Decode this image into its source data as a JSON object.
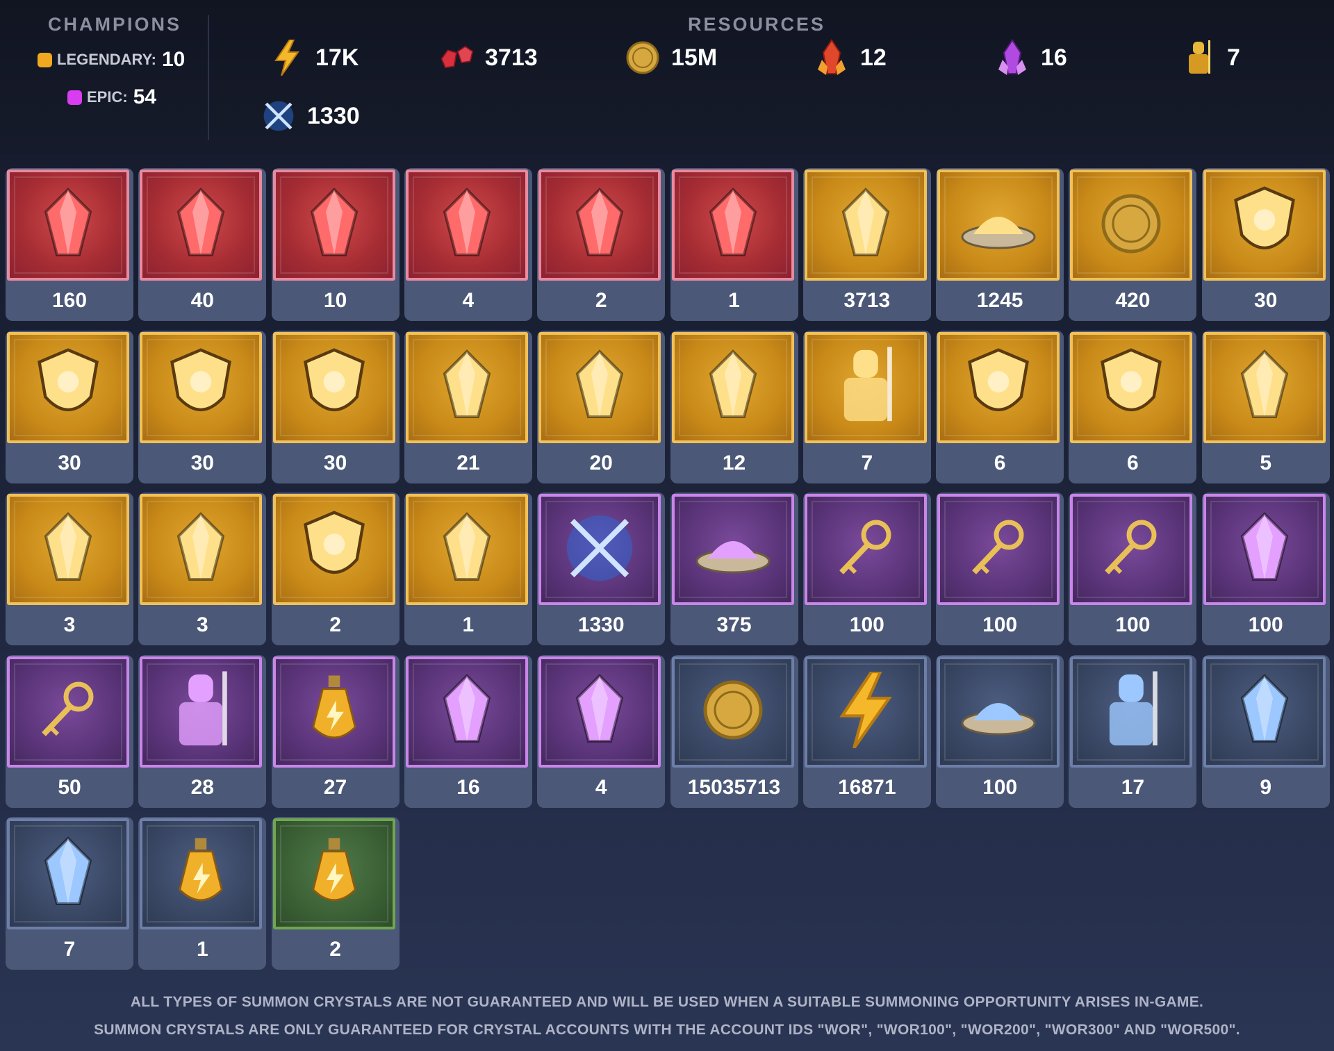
{
  "champions": {
    "title": "CHAMPIONS",
    "legendary_label": "LEGENDARY:",
    "legendary_value": "10",
    "epic_label": "EPIC:",
    "epic_value": "54",
    "colors": {
      "legendary": "#f0a820",
      "epic": "#d83df0"
    }
  },
  "resources": {
    "title": "RESOURCES",
    "items": [
      {
        "icon": "energy-bolt-icon",
        "value": "17K"
      },
      {
        "icon": "ruby-gems-icon",
        "value": "3713"
      },
      {
        "icon": "gold-coin-icon",
        "value": "15M"
      },
      {
        "icon": "red-crystal-icon",
        "value": "12"
      },
      {
        "icon": "purple-crystal-icon",
        "value": "16"
      },
      {
        "icon": "gold-knight-icon",
        "value": "7"
      },
      {
        "icon": "crossed-swords-icon",
        "value": "1330"
      }
    ]
  },
  "items": [
    {
      "tier": "red",
      "icon": "red-crystal-shard-icon",
      "value": "160"
    },
    {
      "tier": "red",
      "icon": "gold-claw-ruby-icon",
      "value": "40"
    },
    {
      "tier": "red",
      "icon": "spider-medallion-icon",
      "value": "10"
    },
    {
      "tier": "red",
      "icon": "pyramid-gem-icon",
      "value": "4"
    },
    {
      "tier": "red",
      "icon": "purple-hex-gem-icon",
      "value": "2"
    },
    {
      "tier": "red",
      "icon": "chameleon-medallion-icon",
      "value": "1"
    },
    {
      "tier": "gold",
      "icon": "ruby-gems-icon",
      "value": "3713"
    },
    {
      "tier": "gold",
      "icon": "fire-dust-bowl-icon",
      "value": "1245"
    },
    {
      "tier": "gold",
      "icon": "rune-coin-icon",
      "value": "420"
    },
    {
      "tier": "gold",
      "icon": "blue-shield-emblem-icon",
      "value": "30"
    },
    {
      "tier": "gold",
      "icon": "red-shield-emblem-icon",
      "value": "30"
    },
    {
      "tier": "gold",
      "icon": "gold-shield-emblem-icon",
      "value": "30"
    },
    {
      "tier": "gold",
      "icon": "green-shield-emblem-icon",
      "value": "30"
    },
    {
      "tier": "gold",
      "icon": "golden-orb-icon",
      "value": "21"
    },
    {
      "tier": "gold",
      "icon": "ruby-claw-icon",
      "value": "20"
    },
    {
      "tier": "gold",
      "icon": "red-crystal-icon",
      "value": "12"
    },
    {
      "tier": "gold",
      "icon": "gold-knight-icon",
      "value": "7"
    },
    {
      "tier": "gold",
      "icon": "sun-crest-shield-icon",
      "value": "6"
    },
    {
      "tier": "gold",
      "icon": "sword-crest-shield-icon",
      "value": "6"
    },
    {
      "tier": "gold",
      "icon": "blue-tome-icon",
      "value": "5"
    },
    {
      "tier": "gold",
      "icon": "war-hammer-icon",
      "value": "3"
    },
    {
      "tier": "gold",
      "icon": "golden-spark-icon",
      "value": "3"
    },
    {
      "tier": "gold",
      "icon": "strength-crest-icon",
      "value": "2"
    },
    {
      "tier": "gold",
      "icon": "scroll-quill-icon",
      "value": "1"
    },
    {
      "tier": "purple",
      "icon": "crossed-swords-icon",
      "value": "1330"
    },
    {
      "tier": "purple",
      "icon": "purple-dust-bowl-icon",
      "value": "375"
    },
    {
      "tier": "purple",
      "icon": "diamond-key-icon",
      "value": "100"
    },
    {
      "tier": "purple",
      "icon": "triangle-key-icon",
      "value": "100"
    },
    {
      "tier": "purple",
      "icon": "ring-key-icon",
      "value": "100"
    },
    {
      "tier": "purple",
      "icon": "ore-chunk-icon",
      "value": "100"
    },
    {
      "tier": "purple",
      "icon": "ruby-key-icon",
      "value": "50"
    },
    {
      "tier": "purple",
      "icon": "purple-knight-icon",
      "value": "28"
    },
    {
      "tier": "purple",
      "icon": "energy-potion-icon",
      "value": "27"
    },
    {
      "tier": "purple",
      "icon": "purple-crystal-icon",
      "value": "16"
    },
    {
      "tier": "purple",
      "icon": "rune-stone-icon",
      "value": "4"
    },
    {
      "tier": "blue",
      "icon": "gold-coin-icon",
      "value": "15035713"
    },
    {
      "tier": "blue",
      "icon": "energy-bolt-icon",
      "value": "16871"
    },
    {
      "tier": "blue",
      "icon": "blue-dust-bowl-icon",
      "value": "100"
    },
    {
      "tier": "blue",
      "icon": "blue-knight-icon",
      "value": "17"
    },
    {
      "tier": "blue",
      "icon": "sapphire-amulet-icon",
      "value": "9"
    },
    {
      "tier": "blue",
      "icon": "blue-crystal-icon",
      "value": "7"
    },
    {
      "tier": "blue",
      "icon": "round-energy-potion-icon",
      "value": "1"
    },
    {
      "tier": "green",
      "icon": "small-energy-potion-icon",
      "value": "2"
    }
  ],
  "footer": {
    "line1": "ALL TYPES OF SUMMON CRYSTALS ARE NOT GUARANTEED AND WILL BE USED WHEN A SUITABLE SUMMONING OPPORTUNITY ARISES IN-GAME.",
    "line2": "SUMMON CRYSTALS ARE ONLY GUARANTEED FOR CRYSTAL ACCOUNTS WITH THE ACCOUNT IDS \"WOR\", \"WOR100\", \"WOR200\", \"WOR300\" AND \"WOR500\"."
  }
}
